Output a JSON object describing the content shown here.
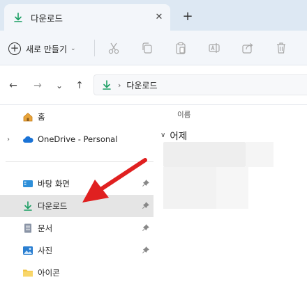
{
  "tab": {
    "title": "다운로드",
    "close_glyph": "✕",
    "new_tab_glyph": "+"
  },
  "toolbar": {
    "new_label": "새로 만들기",
    "icons": [
      "cut-icon",
      "copy-icon",
      "paste-icon",
      "rename-icon",
      "share-icon",
      "delete-icon"
    ]
  },
  "address": {
    "back_glyph": "←",
    "forward_glyph": "→",
    "recent_glyph": "⌄",
    "up_glyph": "↑",
    "separator": "›",
    "crumb": "다운로드"
  },
  "sidebar": {
    "items": [
      {
        "label": "홈",
        "icon": "home-icon"
      },
      {
        "label": "OneDrive - Personal",
        "icon": "cloud-icon"
      },
      {
        "label": "바탕 화면",
        "icon": "desktop-icon",
        "pinned": true
      },
      {
        "label": "다운로드",
        "icon": "download-icon",
        "pinned": true,
        "selected": true
      },
      {
        "label": "문서",
        "icon": "document-icon",
        "pinned": true
      },
      {
        "label": "사진",
        "icon": "pictures-icon",
        "pinned": true
      },
      {
        "label": "아이콘",
        "icon": "folder-icon"
      }
    ]
  },
  "content": {
    "column_name": "이름",
    "group_label": "어제"
  },
  "colors": {
    "accent": "#0f9d58",
    "annotation_arrow": "#e02020",
    "selected_bg": "#e5e5e5",
    "tabstrip_bg": "#dde8f3"
  }
}
